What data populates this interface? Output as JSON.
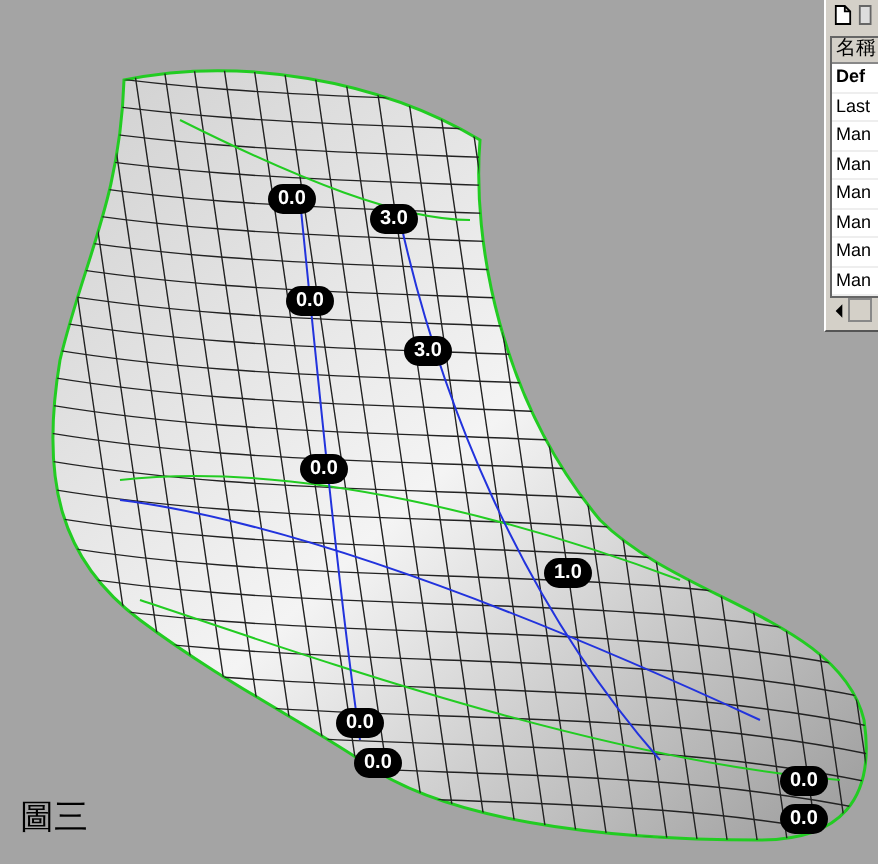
{
  "viewport": {
    "caption": "圖三",
    "thickness_labels": [
      {
        "text": "0.0"
      },
      {
        "text": "3.0"
      },
      {
        "text": "0.0"
      },
      {
        "text": "3.0"
      },
      {
        "text": "0.0"
      },
      {
        "text": "1.0"
      },
      {
        "text": "0.0"
      },
      {
        "text": "0.0"
      },
      {
        "text": "0.0"
      },
      {
        "text": "0.0"
      }
    ]
  },
  "layer_panel": {
    "column": "名稱",
    "rows": [
      {
        "name": "Def",
        "current": true
      },
      {
        "name": "Last",
        "current": false
      },
      {
        "name": "Man",
        "current": false
      },
      {
        "name": "Man",
        "current": false
      },
      {
        "name": "Man",
        "current": false
      },
      {
        "name": "Man",
        "current": false
      },
      {
        "name": "Man",
        "current": false
      },
      {
        "name": "Man",
        "current": false
      }
    ]
  }
}
